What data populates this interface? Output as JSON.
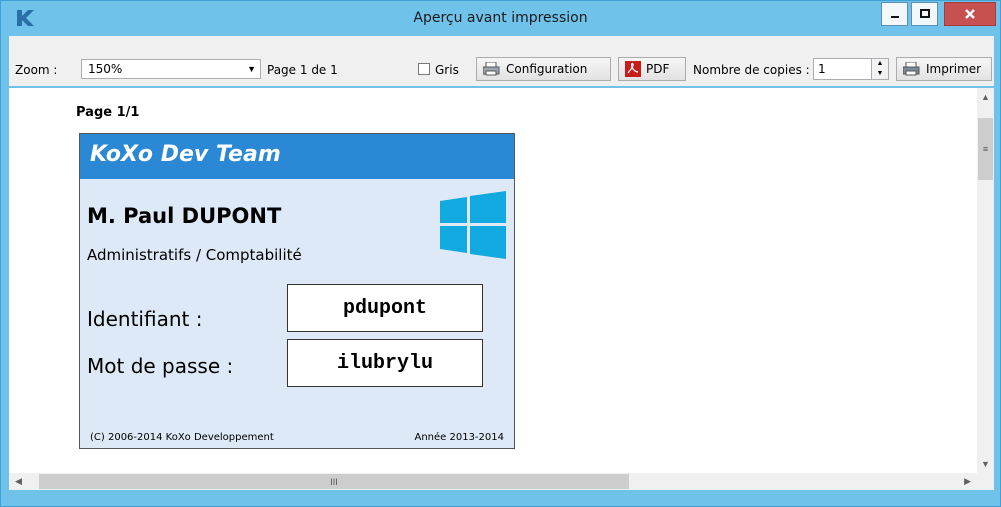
{
  "window": {
    "title": "Aperçu avant impression",
    "accent": "#6fc3ea",
    "close_color": "#c75050"
  },
  "toolbar": {
    "zoom_label": "Zoom :",
    "zoom_value": "150%",
    "page_info": "Page 1 de 1",
    "gray_label": "Gris",
    "gray_checked": false,
    "config_label": "Configuration",
    "pdf_label": "PDF",
    "copies_label": "Nombre de copies :",
    "copies_value": "1",
    "print_label": "Imprimer"
  },
  "preview": {
    "page_label": "Page 1/1",
    "card": {
      "header": "KoXo Dev Team",
      "header_color": "#2a88d4",
      "name": "M. Paul DUPONT",
      "department": "Administratifs / Comptabilité",
      "id_label": "Identifiant :",
      "id_value": "pdupont",
      "pwd_label": "Mot de passe :",
      "pwd_value": "ilubrylu",
      "footer_left": "(C) 2006-2014 KoXo Developpement",
      "footer_right": "Année 2013-2014",
      "logo_icon": "windows-logo-icon"
    }
  },
  "scrollbars": {
    "vertical_thumb_glyph": "≡",
    "horizontal_thumb_glyph": "III"
  }
}
